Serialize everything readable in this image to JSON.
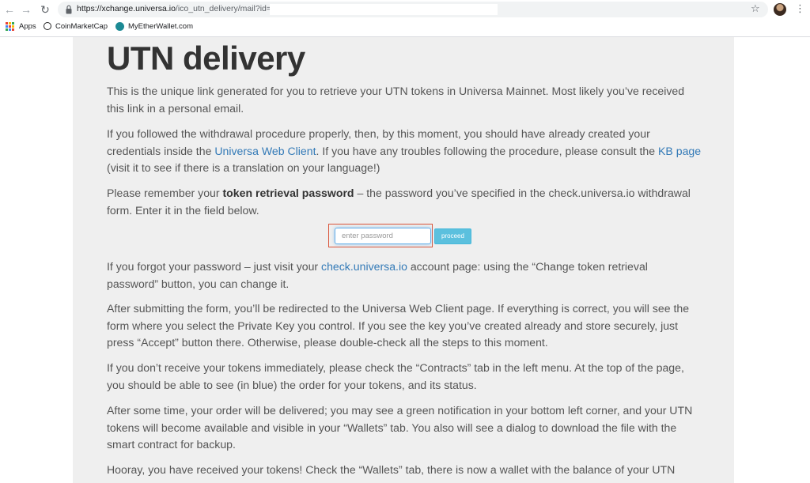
{
  "browser": {
    "url_host": "https://xchange.universa.io",
    "url_path": "/ico_utn_delivery/mail?id=",
    "bookmarks": [
      {
        "label": "Apps",
        "icon": "apps-grid-icon"
      },
      {
        "label": "CoinMarketCap",
        "icon": "coinmarketcap-icon"
      },
      {
        "label": "MyEtherWallet.com",
        "icon": "myetherwallet-icon"
      }
    ]
  },
  "page": {
    "title": "UTN delivery",
    "p1": "This is the unique link generated for you to retrieve your UTN tokens in Universa Mainnet. Most likely you’ve received this link in a personal email.",
    "p2": {
      "before": "If you followed the withdrawal procedure properly, then, by this moment, you should have already created your credentials inside the ",
      "link1": "Universa Web Client",
      "middle": ". If you have any troubles following the procedure, please consult the ",
      "link2": "KB page",
      "after": " (visit it to see if there is a translation on your language!)"
    },
    "p3": {
      "before": "Please remember your ",
      "bold": "token retrieval password",
      "after": " – the password you’ve specified in the check.universa.io withdrawal form. Enter it in the field below."
    },
    "form": {
      "placeholder": "enter password",
      "value": "",
      "button_label": "proceed"
    },
    "p4": {
      "before": "If you forgot your password – just visit your ",
      "link": "check.universa.io",
      "after": " account page: using the “Change token retrieval password” button, you can change it."
    },
    "p5": "After submitting the form, you’ll be redirected to the Universa Web Client page. If everything is correct, you will see the form where you select the Private Key you control. If you see the key you’ve created already and store securely, just press “Accept” button there. Otherwise, please double-check all the steps to this moment.",
    "p6": "If you don’t receive your tokens immediately, please check the “Contracts” tab in the left menu. At the top of the page, you should be able to see (in blue) the order for your tokens, and its status.",
    "p7": "After some time, your order will be delivered; you may see a green notification in your bottom left corner, and your UTN tokens will become available and visible in your “Wallets” tab. You also will see a dialog to download the file with the smart contract for backup.",
    "p8": "Hooray, you have received your tokens! Check the “Wallets” tab, there is now a wallet with the balance of your UTN"
  },
  "colors": {
    "link": "#337ab7",
    "button": "#5bc0de",
    "highlight": "#d9543a",
    "page_bg": "#efefef"
  }
}
